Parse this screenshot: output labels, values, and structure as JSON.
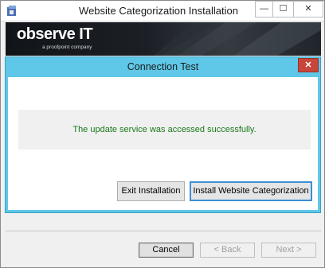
{
  "installer": {
    "title": "Website Categorization Installation",
    "minimize_icon": "minimize-icon",
    "maximize_icon": "maximize-icon",
    "close_icon": "close-icon",
    "minimize_glyph": "—",
    "maximize_glyph": "☐",
    "close_glyph": "✕"
  },
  "banner": {
    "logo_text": "observe IT",
    "logo_subtext": "a proofpoint company"
  },
  "dialog": {
    "title": "Connection Test",
    "close_glyph": "✕",
    "message": "The update service was accessed successfully.",
    "exit_label": "Exit Installation",
    "install_label": "Install Website Categorization"
  },
  "footer": {
    "cancel_label": "Cancel",
    "back_label": "< Back",
    "next_label": "Next >"
  },
  "colors": {
    "dialog_frame": "#5fc8e8",
    "success_text": "#1a7a1a",
    "dialog_close": "#c7463b",
    "focus_border": "#3c8fd4"
  }
}
